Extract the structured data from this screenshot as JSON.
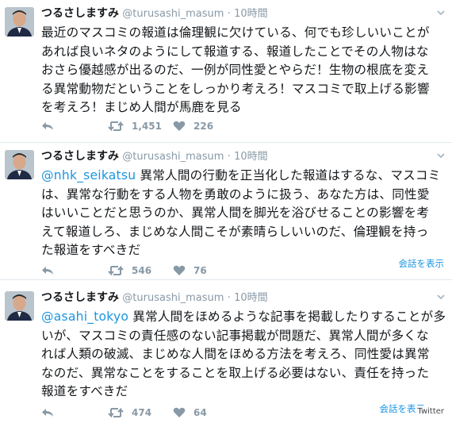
{
  "colors": {
    "accent": "#1b95e0",
    "muted": "#8899a6",
    "divider": "#e1e8ed"
  },
  "tweets": [
    {
      "name": "つるさしますみ",
      "handle": "@turusashi_masum",
      "separator": "·",
      "time": "10時間",
      "mention": "",
      "lines": [
        "最近のマスコミの報道は倫理観に欠けている、何でも珍しいいことが",
        "あれば良いネタのようにして報道する、報道したことでその人物はな",
        "おさら優越感が出るのだ、一例が同性愛とやらだ！生物の根底を変え",
        "る異常動物だということをしっかり考えろ！マスコミで取上げる影響",
        "を考えろ！まじめ人間が馬鹿を見る"
      ],
      "retweets": "1,451",
      "likes": "226",
      "conversation": ""
    },
    {
      "name": "つるさしますみ",
      "handle": "@turusashi_masum",
      "separator": "·",
      "time": "10時間",
      "mention": "@nhk_seikatsu",
      "lines": [
        " 異常人間の行動を正当化した報道はするな、マスコミ",
        "は、異常な行動をする人物を勇敢のように扱う、あなた方は、同性愛",
        "はいいことだと思うのか、異常人間を脚光を浴びせることの影響を考",
        "えて報道しろ、まじめな人間こそが素晴らしいいのだ、倫理観を持っ",
        "た報道をすべきだ"
      ],
      "retweets": "546",
      "likes": "76",
      "conversation": "会話を表示"
    },
    {
      "name": "つるさしますみ",
      "handle": "@turusashi_masum",
      "separator": "·",
      "time": "10時間",
      "mention": "@asahi_tokyo",
      "lines": [
        " 異常人間をほめるような記事を掲載したりすることが多",
        "いが、マスコミの責任感のない記事掲載が問題だ、異常人間が多くな",
        "れば人類の破滅、まじめな人間をほめる方法を考えろ、同性愛は異常",
        "なのだ、異常なことをすることを取上げる必要はない、責任を持った",
        "報道をすべきだ"
      ],
      "retweets": "474",
      "likes": "64",
      "conversation": "会話を表示"
    }
  ],
  "watermark": "Twitter"
}
